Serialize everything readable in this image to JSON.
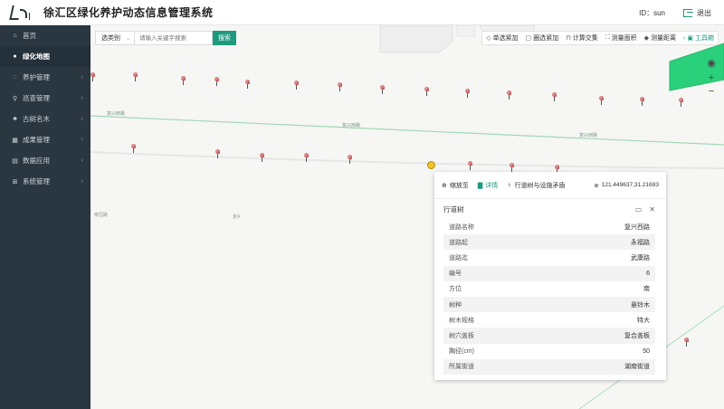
{
  "header": {
    "title": "徐汇区绿化养护动态信息管理系统",
    "user_label": "ID：sun",
    "logout_label": "退出"
  },
  "sidebar": {
    "items": [
      {
        "label": "首页",
        "icon": "home-icon",
        "glyph": "⌂"
      },
      {
        "label": "绿化地图",
        "icon": "globe-icon",
        "glyph": "●",
        "active": true
      },
      {
        "label": "养护管理",
        "icon": "leaf-icon",
        "glyph": "◌",
        "has_children": true
      },
      {
        "label": "巡查管理",
        "icon": "search-icon",
        "glyph": "⚲",
        "has_children": true
      },
      {
        "label": "古树名木",
        "icon": "tree-icon",
        "glyph": "♣",
        "has_children": true
      },
      {
        "label": "成果管理",
        "icon": "grid-icon",
        "glyph": "▦",
        "has_children": true
      },
      {
        "label": "数据应用",
        "icon": "database-icon",
        "glyph": "▤",
        "has_children": true
      },
      {
        "label": "系统管理",
        "icon": "sitemap-icon",
        "glyph": "⊞",
        "has_children": true
      }
    ]
  },
  "search": {
    "category_label": "选类别",
    "placeholder": "请输入关键字搜索",
    "button_label": "搜索"
  },
  "toolbar": {
    "tools": [
      {
        "label": "单选紧加",
        "icon": "tag-icon",
        "glyph": "◇"
      },
      {
        "label": "圈选紧加",
        "icon": "copy-icon",
        "glyph": "▢"
      },
      {
        "label": "计算交集",
        "icon": "intersect-icon",
        "glyph": "⊓"
      },
      {
        "label": "测量面积",
        "icon": "area-icon",
        "glyph": "⛶"
      },
      {
        "label": "测量距离",
        "icon": "ruler-icon",
        "glyph": "◆"
      },
      {
        "label": "工具箱",
        "icon": "toolbox-icon",
        "glyph": "▣",
        "accent": true
      }
    ]
  },
  "map": {
    "controls": {
      "locate": "◉",
      "zoom_in": "+",
      "zoom_out": "−"
    },
    "street_labels": [
      "复兴西路",
      "复兴西路",
      "复兴西路"
    ],
    "poi_labels": [
      "泰园路",
      "复A"
    ]
  },
  "popup": {
    "actions": {
      "zoom_label": "缩放至",
      "detail_label": "详情",
      "relation_label": "行道树与设施矛盾"
    },
    "coords": "121.449637,31.21693",
    "section_title": "行道树",
    "rows": [
      {
        "key": "道路名称",
        "value": "复兴西路"
      },
      {
        "key": "道路起",
        "value": "永福路"
      },
      {
        "key": "道路迄",
        "value": "武康路"
      },
      {
        "key": "编号",
        "value": "6"
      },
      {
        "key": "方位",
        "value": "南"
      },
      {
        "key": "树种",
        "value": "悬铃木"
      },
      {
        "key": "树木规格",
        "value": "特大"
      },
      {
        "key": "树穴盖板",
        "value": "复合盖板"
      },
      {
        "key": "胸径(cm)",
        "value": "50"
      },
      {
        "key": "所属街道",
        "value": "湖南街道"
      }
    ]
  },
  "colors": {
    "accent": "#1e9a7e",
    "sidebar_bg": "#2a3640",
    "sidebar_active": "#24303a",
    "park_green": "#2bd07a"
  }
}
